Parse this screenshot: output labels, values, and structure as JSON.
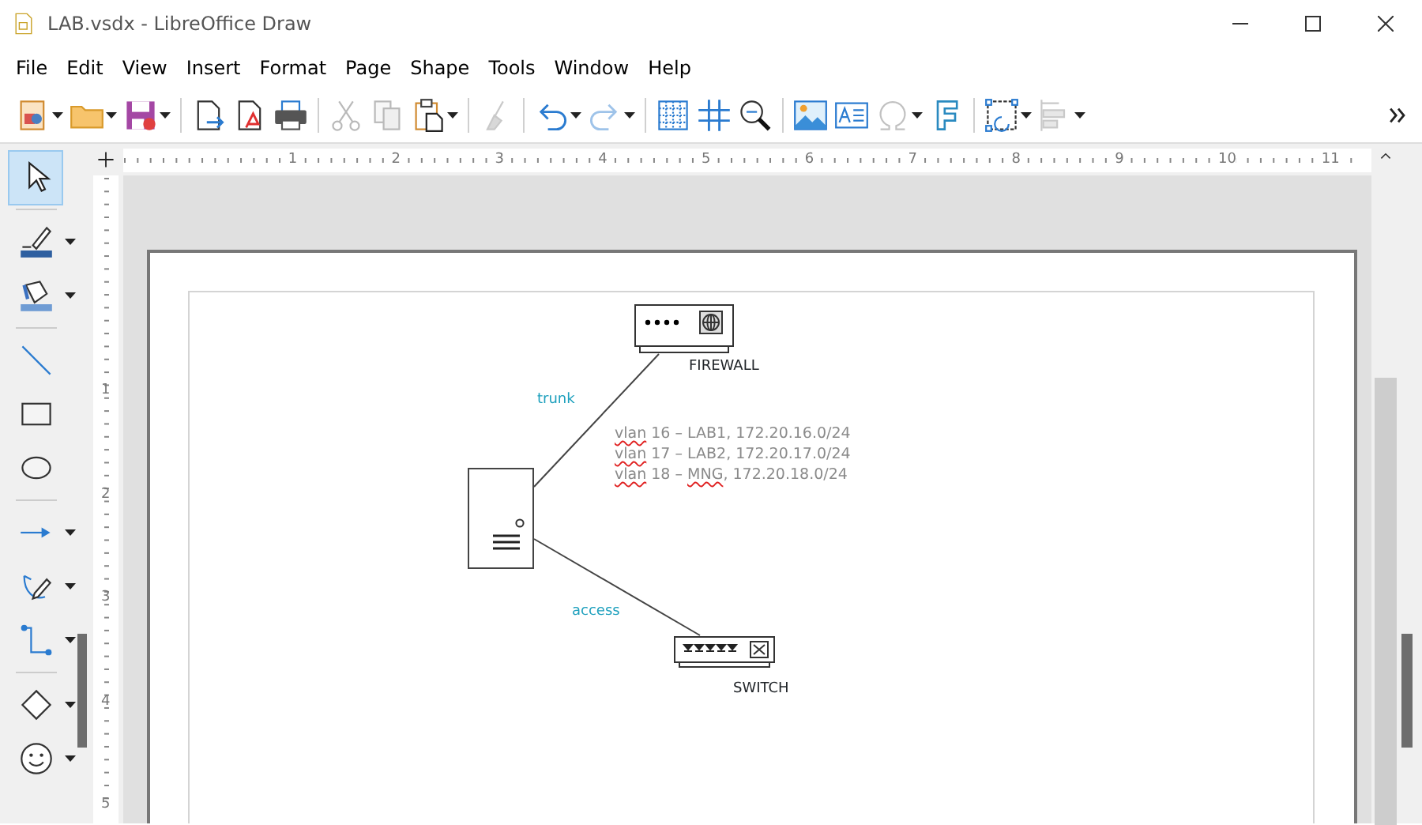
{
  "window": {
    "title": "LAB.vsdx - LibreOffice Draw"
  },
  "menu": [
    "File",
    "Edit",
    "View",
    "Insert",
    "Format",
    "Page",
    "Shape",
    "Tools",
    "Window",
    "Help"
  ],
  "main_toolbar": [
    {
      "kind": "new",
      "dropdown": true,
      "disabled": false
    },
    {
      "kind": "open",
      "dropdown": true,
      "disabled": false
    },
    {
      "kind": "save",
      "dropdown": true,
      "disabled": false
    },
    {
      "kind": "separator"
    },
    {
      "kind": "export",
      "dropdown": false,
      "disabled": false
    },
    {
      "kind": "export-pdf",
      "dropdown": false,
      "disabled": false
    },
    {
      "kind": "print",
      "dropdown": false,
      "disabled": false
    },
    {
      "kind": "separator"
    },
    {
      "kind": "cut",
      "dropdown": false,
      "disabled": true
    },
    {
      "kind": "copy",
      "dropdown": false,
      "disabled": true
    },
    {
      "kind": "paste",
      "dropdown": true,
      "disabled": false
    },
    {
      "kind": "separator"
    },
    {
      "kind": "clone",
      "dropdown": false,
      "disabled": true
    },
    {
      "kind": "separator"
    },
    {
      "kind": "undo",
      "dropdown": true,
      "disabled": false
    },
    {
      "kind": "redo",
      "dropdown": true,
      "disabled": true
    },
    {
      "kind": "separator"
    },
    {
      "kind": "grid",
      "dropdown": false,
      "disabled": false
    },
    {
      "kind": "snap",
      "dropdown": false,
      "disabled": false
    },
    {
      "kind": "zoom",
      "dropdown": false,
      "disabled": false
    },
    {
      "kind": "separator"
    },
    {
      "kind": "image",
      "dropdown": false,
      "disabled": false
    },
    {
      "kind": "textbox",
      "dropdown": false,
      "disabled": false
    },
    {
      "kind": "special",
      "dropdown": true,
      "disabled": true
    },
    {
      "kind": "fontwork",
      "dropdown": false,
      "disabled": false
    },
    {
      "kind": "separator"
    },
    {
      "kind": "transform",
      "dropdown": true,
      "disabled": false
    },
    {
      "kind": "align",
      "dropdown": true,
      "disabled": true
    }
  ],
  "drawing_toolbar": [
    {
      "kind": "select",
      "dropdown": false,
      "selected": true
    },
    {
      "kind": "separator"
    },
    {
      "kind": "line-color",
      "dropdown": true,
      "selected": false
    },
    {
      "kind": "fill-color",
      "dropdown": true,
      "selected": false
    },
    {
      "kind": "separator"
    },
    {
      "kind": "line",
      "dropdown": false,
      "selected": false
    },
    {
      "kind": "rect",
      "dropdown": false,
      "selected": false
    },
    {
      "kind": "ellipse",
      "dropdown": false,
      "selected": false
    },
    {
      "kind": "separator"
    },
    {
      "kind": "arrow",
      "dropdown": true,
      "selected": false
    },
    {
      "kind": "curve",
      "dropdown": true,
      "selected": false
    },
    {
      "kind": "connector",
      "dropdown": true,
      "selected": false
    },
    {
      "kind": "separator"
    },
    {
      "kind": "diamond",
      "dropdown": true,
      "selected": false
    },
    {
      "kind": "smiley",
      "dropdown": true,
      "selected": false
    }
  ],
  "rulers": {
    "horizontal": [
      "1",
      "2",
      "3",
      "4",
      "5",
      "6",
      "7",
      "8",
      "9",
      "10",
      "11"
    ],
    "vertical": [
      "1",
      "2",
      "3",
      "4",
      "5"
    ]
  },
  "diagram": {
    "nodes": [
      {
        "kind": "firewall",
        "label": "FIREWALL"
      },
      {
        "kind": "server"
      },
      {
        "kind": "switch",
        "label": "SWITCH"
      }
    ],
    "links": [
      {
        "label": "trunk"
      },
      {
        "label": "access"
      }
    ],
    "note": [
      [
        {
          "text": "vlan",
          "misspelled": true
        },
        {
          "text": " 16 – LAB1, 172.20.16.0/24",
          "misspelled": false
        }
      ],
      [
        {
          "text": "vlan",
          "misspelled": true
        },
        {
          "text": " 17 – LAB2, 172.20.17.0/24",
          "misspelled": false
        }
      ],
      [
        {
          "text": "vlan",
          "misspelled": true
        },
        {
          "text": " 18 – ",
          "misspelled": false
        },
        {
          "text": "MNG",
          "misspelled": true
        },
        {
          "text": ", 172.20.18.0/24",
          "misspelled": false
        }
      ]
    ]
  }
}
